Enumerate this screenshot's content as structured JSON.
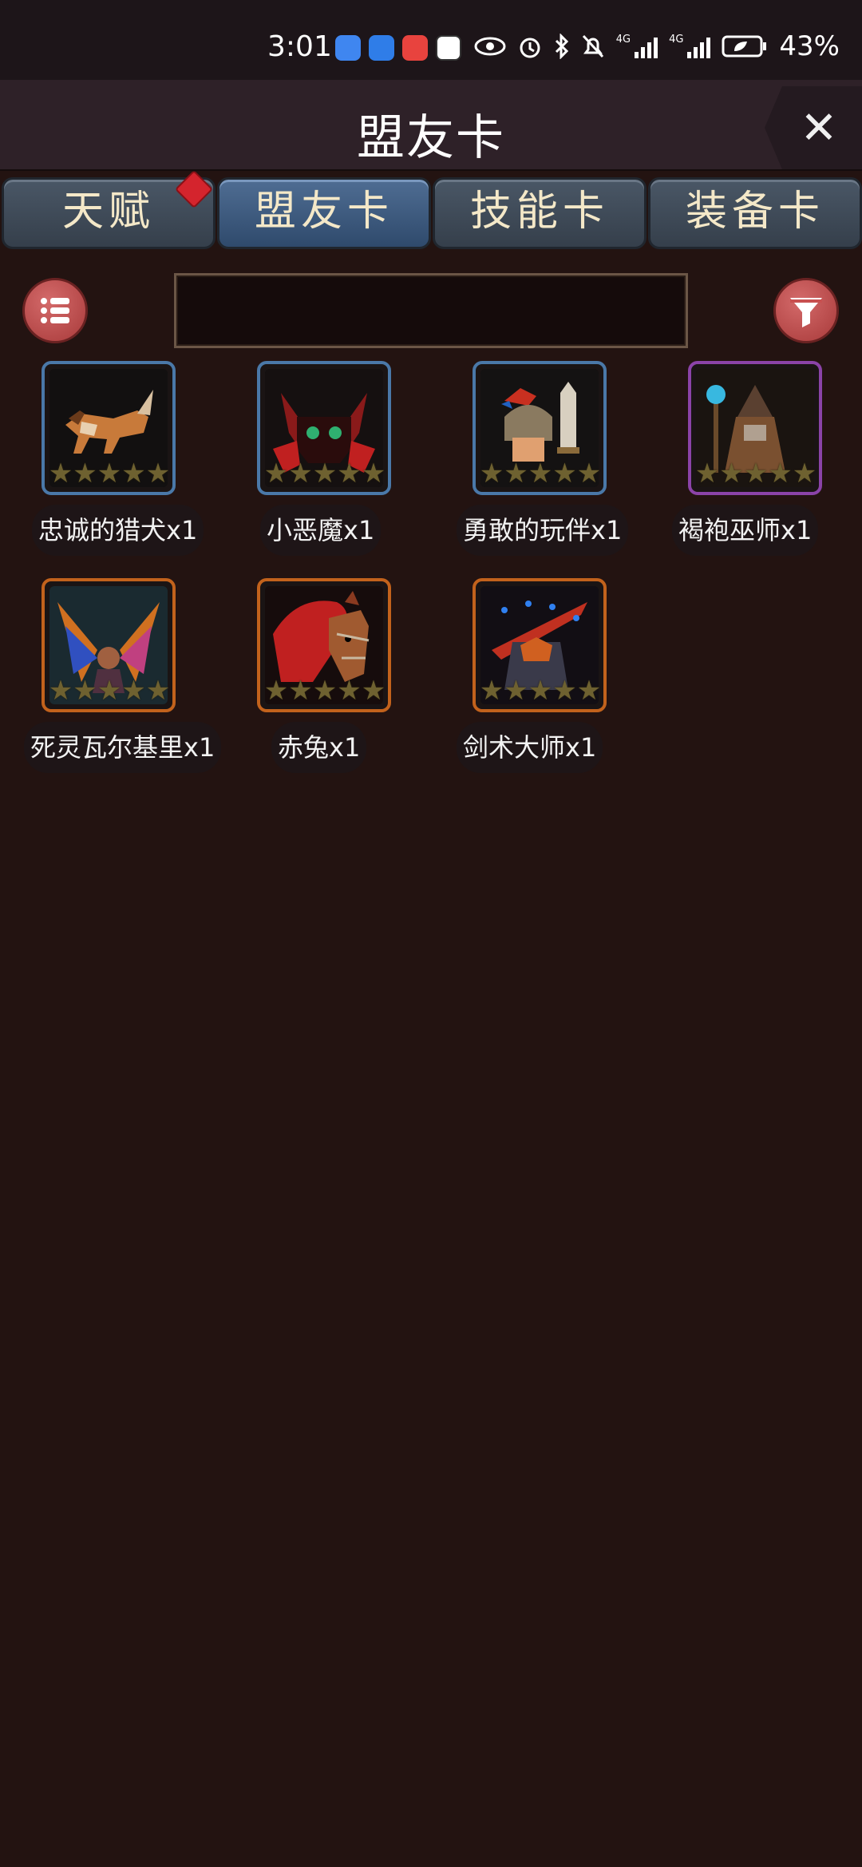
{
  "status_bar": {
    "time": "3:01",
    "network_label_1": "4G",
    "network_label_2": "4G",
    "battery": "43%",
    "icons": [
      "cloud-app-icon",
      "weather-app-icon",
      "book-app-icon",
      "sf-app-icon",
      "eye-icon",
      "alarm-icon",
      "bluetooth-icon",
      "bell-off-icon",
      "signal-icon",
      "battery-icon"
    ]
  },
  "header": {
    "title": "盟友卡",
    "close_icon": "✕"
  },
  "tabs": [
    {
      "label": "天赋",
      "active": false,
      "badge": true
    },
    {
      "label": "盟友卡",
      "active": true,
      "badge": false
    },
    {
      "label": "技能卡",
      "active": false,
      "badge": false
    },
    {
      "label": "装备卡",
      "active": false,
      "badge": false
    }
  ],
  "toolbar": {
    "search_value": "",
    "list_icon": "list-icon",
    "filter_icon": "filter-icon"
  },
  "cards": [
    {
      "name": "忠诚的猎犬x1",
      "frame": "blue",
      "stars": "★★★★★"
    },
    {
      "name": "小恶魔x1",
      "frame": "blue",
      "stars": "★★★★★"
    },
    {
      "name": "勇敢的玩伴x1",
      "frame": "blue",
      "stars": "★★★★★"
    },
    {
      "name": "褐袍巫师x1",
      "frame": "purple",
      "stars": "★★★★★"
    },
    {
      "name": "死灵瓦尔基里x1",
      "frame": "orange",
      "stars": "★★★★★"
    },
    {
      "name": "赤兔x1",
      "frame": "orange",
      "stars": "★★★★★"
    },
    {
      "name": "剑术大师x1",
      "frame": "orange",
      "stars": "★★★★★"
    }
  ],
  "colors": {
    "background": "#231311",
    "tab_active": "#3b5b82",
    "badge_red": "#d4242d",
    "button_red": "#b84444"
  }
}
